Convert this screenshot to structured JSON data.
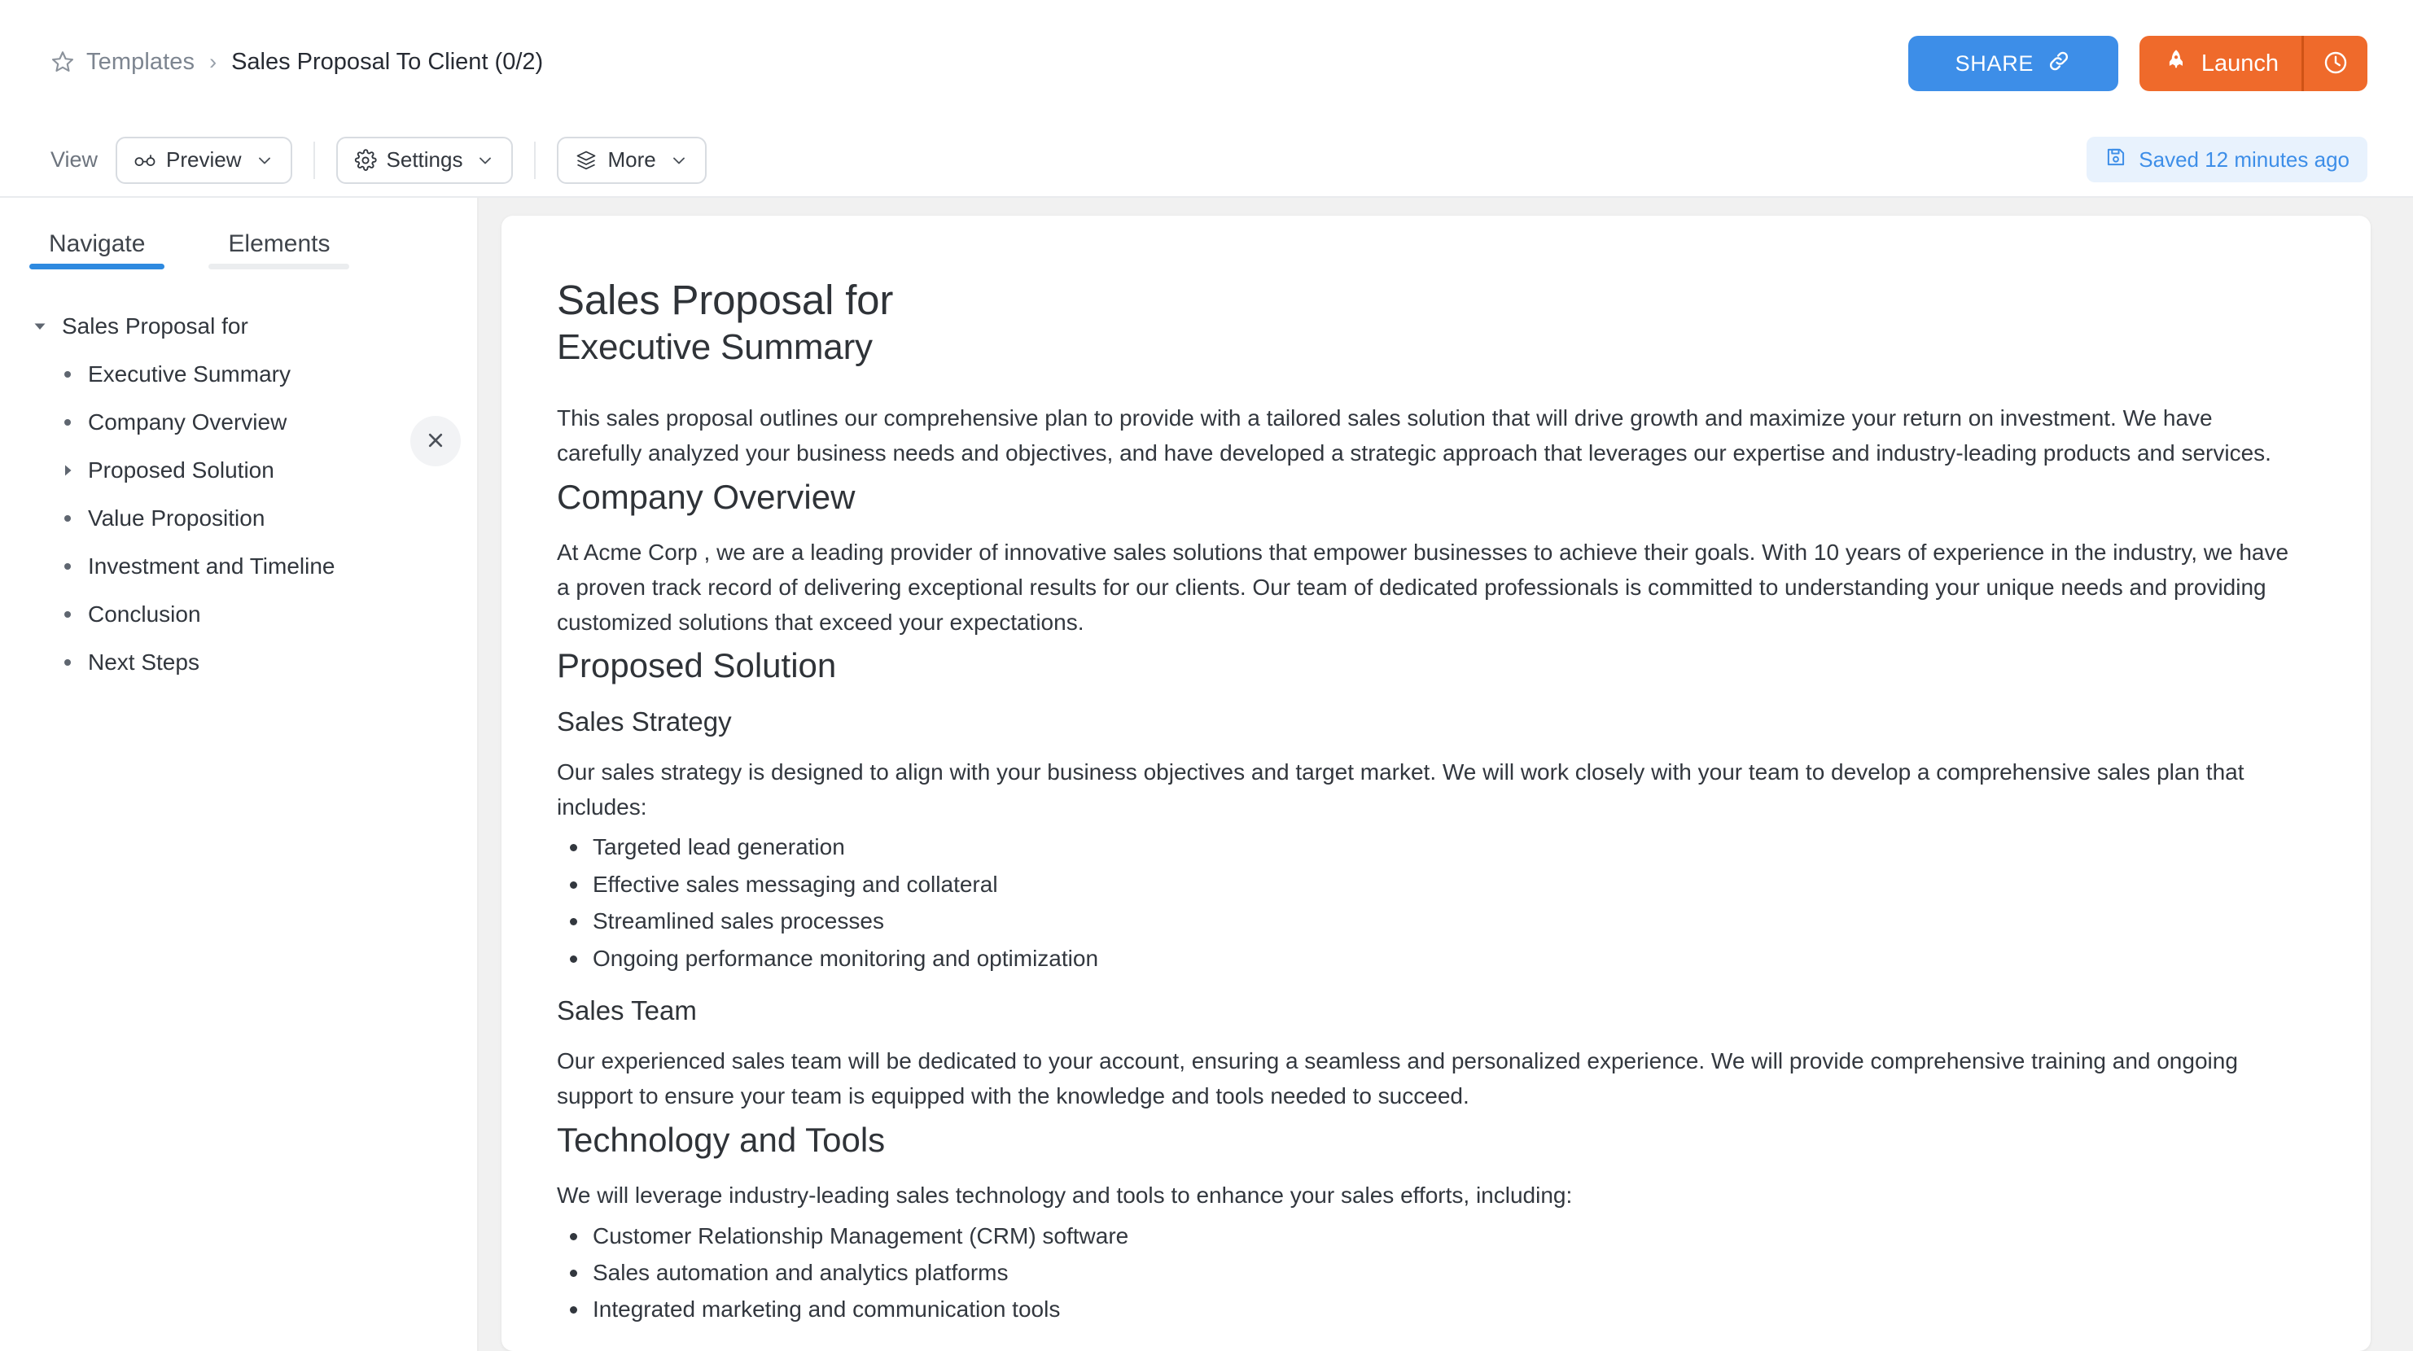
{
  "header": {
    "breadcrumb": {
      "star_icon": "star-icon",
      "root_label": "Templates",
      "separator": "›",
      "current_label": "Sales Proposal To Client (0/2)"
    },
    "share_button": {
      "label": "SHARE",
      "icon": "link-icon",
      "color": "#3d8ee8"
    },
    "launch_button": {
      "label": "Launch",
      "icon": "rocket-icon",
      "color": "#ef6a2b"
    },
    "schedule_button": {
      "icon": "clock-icon"
    }
  },
  "toolbar": {
    "view_label": "View",
    "preview": {
      "label": "Preview",
      "icon": "glasses-icon",
      "chevron": "chevron-down-icon"
    },
    "settings": {
      "label": "Settings",
      "icon": "gear-icon",
      "chevron": "chevron-down-icon"
    },
    "more": {
      "label": "More",
      "icon": "layers-icon",
      "chevron": "chevron-down-icon"
    },
    "saved_badge": {
      "label": "Saved 12 minutes ago",
      "icon": "save-icon",
      "color": "#3d8ee8"
    }
  },
  "sidebar": {
    "tabs": [
      {
        "label": "Navigate",
        "active": true
      },
      {
        "label": "Elements",
        "active": false
      }
    ],
    "close_icon": "close-icon",
    "tree": {
      "root": {
        "label": "Sales Proposal for",
        "marker": "caret-down-icon",
        "expanded": true
      },
      "items": [
        {
          "label": "Executive Summary",
          "marker": "bullet"
        },
        {
          "label": "Company Overview",
          "marker": "bullet"
        },
        {
          "label": "Proposed Solution",
          "marker": "caret-right-icon",
          "expanded": false
        },
        {
          "label": "Value Proposition",
          "marker": "bullet"
        },
        {
          "label": "Investment and Timeline",
          "marker": "bullet"
        },
        {
          "label": "Conclusion",
          "marker": "bullet"
        },
        {
          "label": "Next Steps",
          "marker": "bullet"
        }
      ]
    }
  },
  "document": {
    "title": "Sales Proposal for",
    "subtitle": "Executive Summary",
    "summary_paragraph": "This sales proposal outlines our comprehensive plan to provide  with a tailored sales solution that will drive growth and maximize your return on investment. We have carefully analyzed your business needs and objectives, and have developed a strategic approach that leverages our expertise and industry-leading products and services.",
    "company_overview_heading": "Company Overview",
    "company_overview_paragraph": "At Acme Corp , we are a leading provider of innovative sales solutions that empower businesses to achieve their goals. With 10 years of experience in the industry, we have a proven track record of delivering exceptional results for our clients. Our team of dedicated professionals is committed to understanding your unique needs and providing customized solutions that exceed your expectations.",
    "proposed_solution_heading": "Proposed Solution",
    "sales_strategy_heading": "Sales Strategy",
    "sales_strategy_paragraph": "Our sales strategy is designed to align with your business objectives and target market. We will work closely with your team to develop a comprehensive sales plan that includes:",
    "sales_strategy_bullets": [
      "Targeted lead generation",
      "Effective sales messaging and collateral",
      "Streamlined sales processes",
      "Ongoing performance monitoring and optimization"
    ],
    "sales_team_heading": "Sales Team",
    "sales_team_paragraph": "Our experienced sales team will be dedicated to your account, ensuring a seamless and personalized experience. We will provide comprehensive training and ongoing support to ensure your team is equipped with the knowledge and tools needed to succeed.",
    "technology_heading": "Technology and Tools",
    "technology_paragraph": "We will leverage industry-leading sales technology and tools to enhance your sales efforts, including:",
    "technology_bullets": [
      "Customer Relationship Management (CRM) software",
      "Sales automation and analytics platforms",
      "Integrated marketing and communication tools"
    ]
  }
}
